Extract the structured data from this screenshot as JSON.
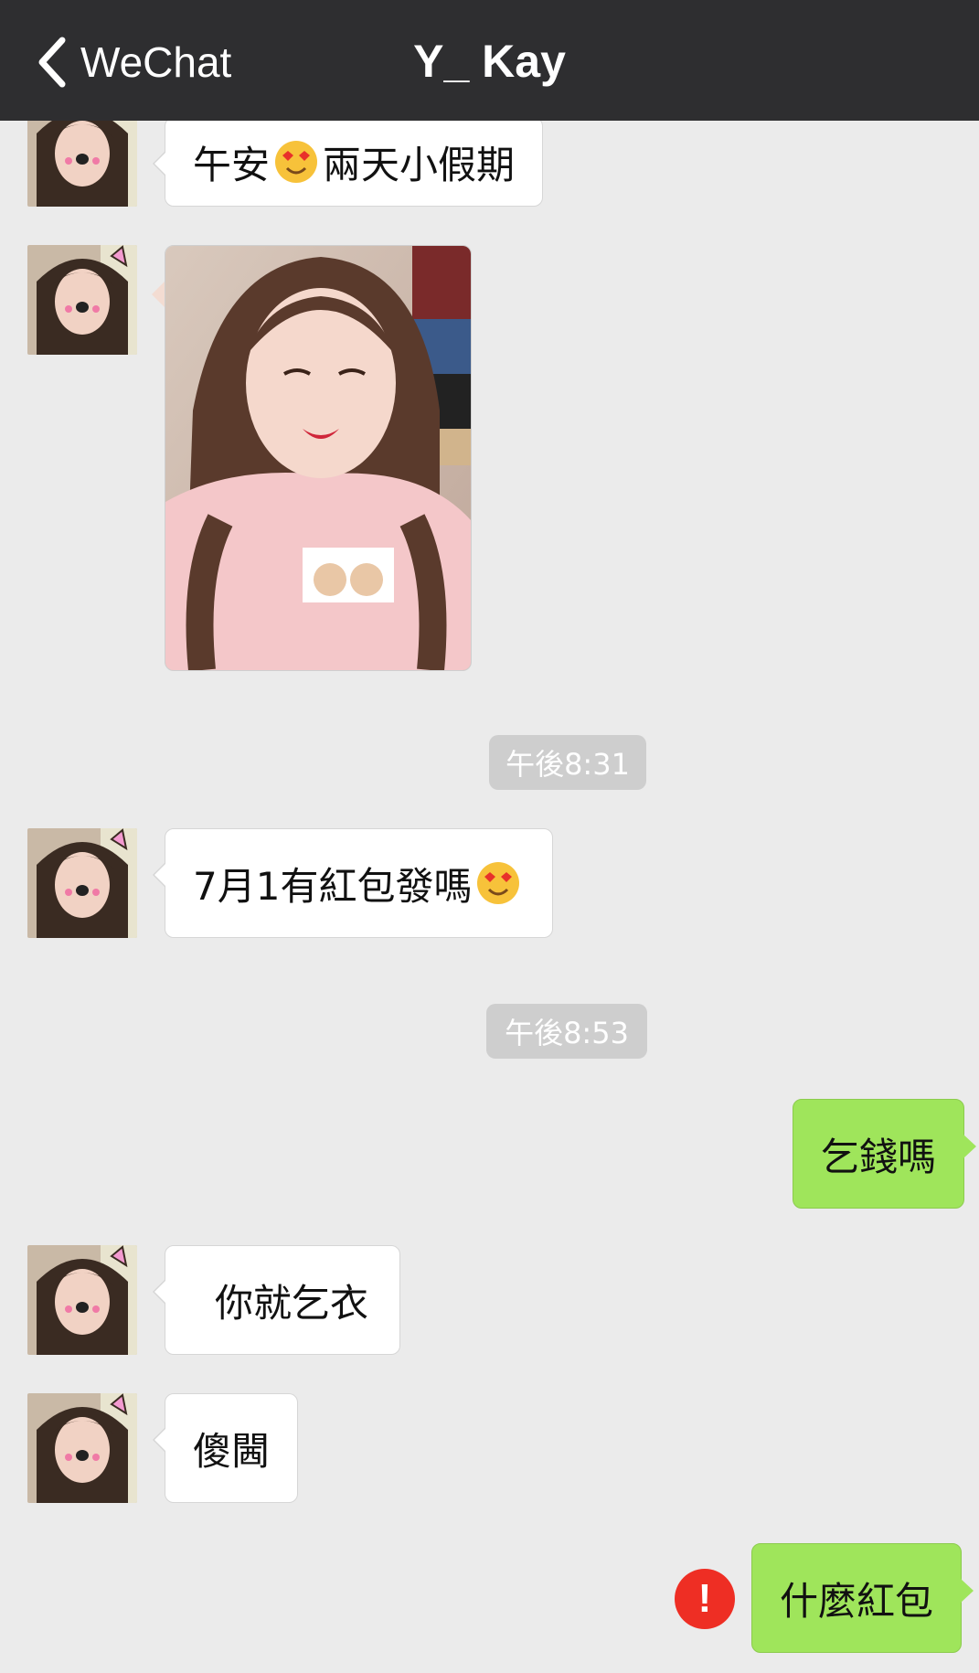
{
  "navbar": {
    "back_label": "WeChat",
    "title": "Y_ Kay"
  },
  "messages": [
    {
      "type": "text-in",
      "before": "午安",
      "emoji": "smiling-face-with-heart-eyes",
      "after": "兩天小假期"
    },
    {
      "type": "image-in",
      "description_icon": "selfie-photo"
    },
    {
      "type": "timestamp",
      "text": "午後8:31"
    },
    {
      "type": "text-in",
      "before": "7月1有紅包發嗎",
      "emoji": "smiling-face-with-heart-eyes"
    },
    {
      "type": "timestamp",
      "text": "午後8:53"
    },
    {
      "type": "text-out",
      "text": "乞錢嗎"
    },
    {
      "type": "text-in",
      "text": "你就乞衣"
    },
    {
      "type": "text-in",
      "text": "傻閪"
    },
    {
      "type": "text-out",
      "text": "什麼紅包",
      "status": "failed",
      "status_icon": "!"
    }
  ],
  "colors": {
    "navbar": "#2e2e30",
    "background": "#ebebeb",
    "incoming_bubble": "#ffffff",
    "outgoing_bubble": "#9fe55b",
    "timestamp_bg": "#cecece",
    "error": "#ee2e24"
  }
}
